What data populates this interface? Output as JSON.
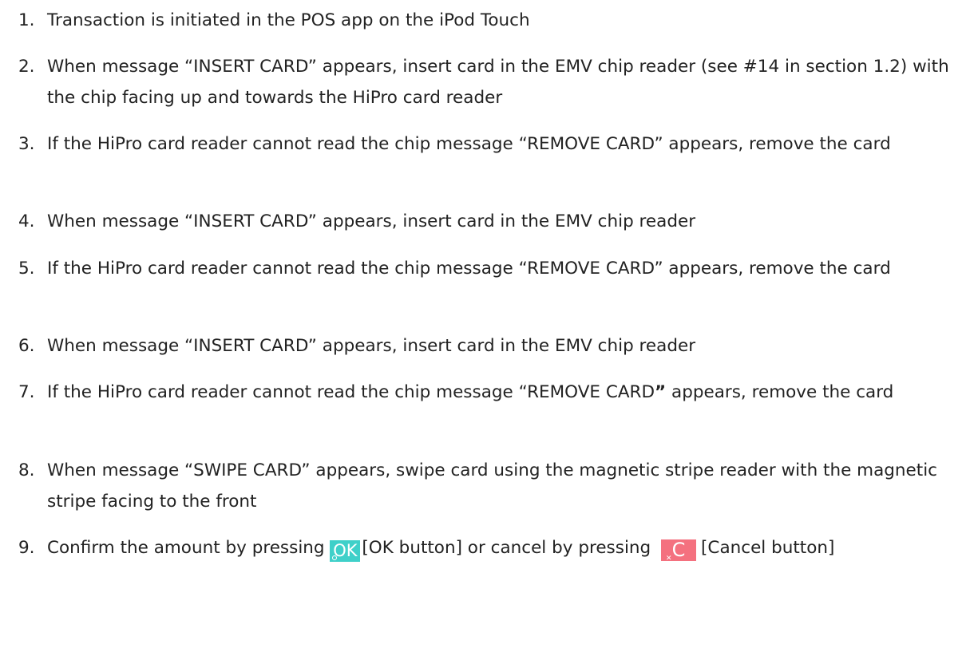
{
  "steps": [
    {
      "num": "1.",
      "text": "Transaction is initiated in the POS app on the iPod Touch"
    },
    {
      "num": "2.",
      "text": "When message “INSERT CARD” appears, insert card in the EMV chip reader (see #14 in section 1.2) with the chip facing up and towards the HiPro card reader"
    },
    {
      "num": "3.",
      "text": "If the HiPro card reader cannot read the chip message “REMOVE CARD” appears, remove the card"
    },
    {
      "num": "4.",
      "text": "When message “INSERT CARD” appears, insert card in the EMV chip reader"
    },
    {
      "num": "5.",
      "text": "If the HiPro card reader cannot read the chip message “REMOVE CARD” appears, remove the card"
    },
    {
      "num": "6.",
      "text": "When message “INSERT CARD” appears, insert card in the EMV chip reader"
    },
    {
      "num": "7.",
      "text_before": "If the HiPro card reader cannot read the chip message “REMOVE CARD",
      "text_quote": "”",
      "text_after": " appears, remove the card"
    },
    {
      "num": "8.",
      "text": "When message “SWIPE CARD” appears, swipe card using the magnetic stripe reader with the magnetic stripe facing to the front"
    },
    {
      "num": "9.",
      "part1": "Confirm the amount by pressing ",
      "ok_icon_label": "OK",
      "part2": "[OK button] or cancel by pressing ",
      "cancel_icon_label": "C",
      "part3": "[Cancel button]"
    }
  ],
  "colors": {
    "ok_icon": "#3fd0c9",
    "cancel_icon": "#f4717f",
    "text": "#222222"
  }
}
